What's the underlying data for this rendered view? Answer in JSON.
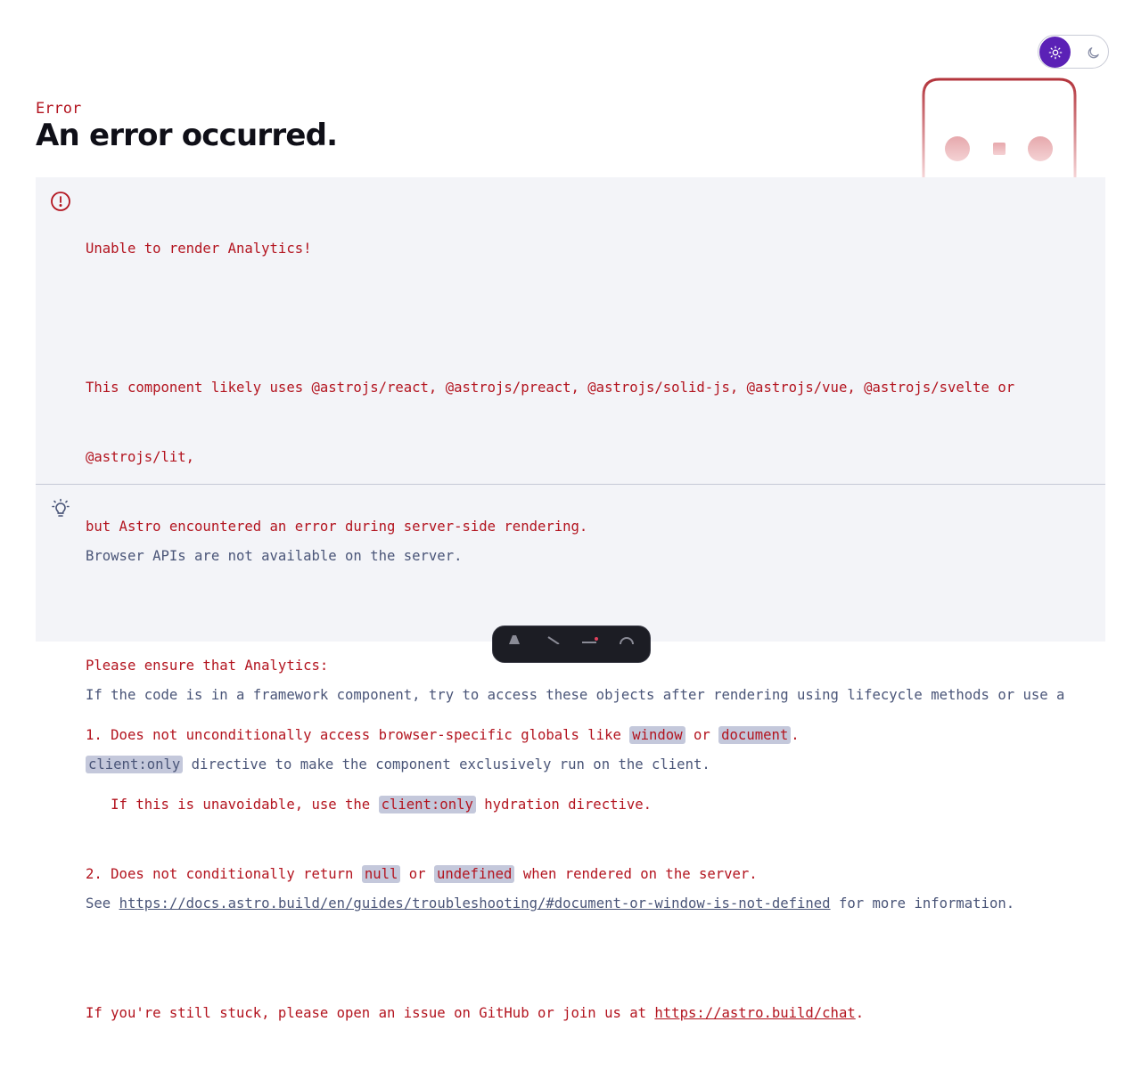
{
  "theme": {
    "sun_icon": "sun-icon",
    "moon_icon": "moon-icon",
    "active": "light",
    "accent": "#5b21b6"
  },
  "header": {
    "label": "Error",
    "title": "An error occurred."
  },
  "error_section": {
    "icon": "alert-circle-icon",
    "color": "#b3141f",
    "title": "Unable to render Analytics!",
    "para1_line1": "This component likely uses @astrojs/react, @astrojs/preact, @astrojs/solid-js, @astrojs/vue, @astrojs/svelte or",
    "para1_line2": "@astrojs/lit,",
    "para1_line3": "but Astro encountered an error during server-side rendering.",
    "ensure_line": "Please ensure that Analytics:",
    "item1_prefix": "1. Does not unconditionally access browser-specific globals like ",
    "item1_code1": "window",
    "item1_or": " or ",
    "item1_code2": "document",
    "item1_end": ".",
    "item1b_prefix": "   If this is unavoidable, use the ",
    "item1b_code": "client:only",
    "item1b_suffix": " hydration directive.",
    "item2_prefix": "2. Does not conditionally return ",
    "item2_code1": "null",
    "item2_or": " or ",
    "item2_code2": "undefined",
    "item2_suffix": " when rendered on the server.",
    "stuck_prefix": "If you're still stuck, please open an issue on GitHub or join us at ",
    "stuck_link": "https://astro.build/chat",
    "stuck_end": "."
  },
  "hint_section": {
    "icon": "lightbulb-icon",
    "color": "#4a5578",
    "title": "Browser APIs are not available on the server.",
    "para_line1": "If the code is in a framework component, try to access these objects after rendering using lifecycle methods or use a",
    "para_code": "client:only",
    "para_line2_suffix": " directive to make the component exclusively run on the client.",
    "see_prefix": "See ",
    "see_link": "https://docs.astro.build/en/guides/troubleshooting/#document-or-window-is-not-defined",
    "see_suffix": " for more information."
  },
  "dev_toolbar": {
    "icons": [
      "astro-logo-icon",
      "inspect-icon",
      "audit-icon",
      "settings-icon"
    ]
  }
}
